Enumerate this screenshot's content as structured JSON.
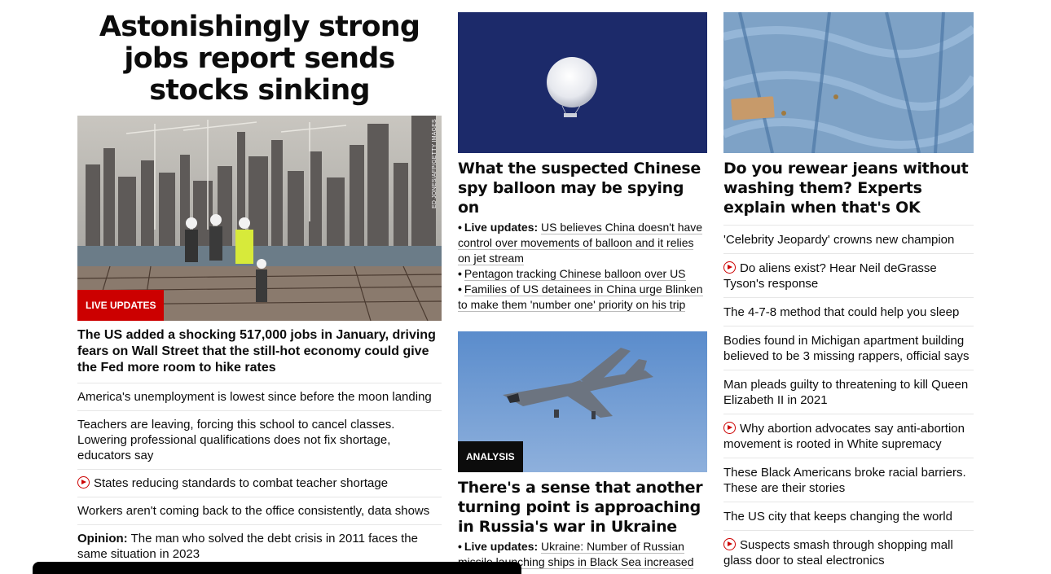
{
  "hero": {
    "title": "Astonishingly strong jobs report sends stocks sinking",
    "photo_credit": "ED JONES/AFP/GETTY IMAGES",
    "badge": "LIVE UPDATES",
    "lead": "The US added a shocking 517,000 jobs in January, driving fears on Wall Street that the still-hot economy could give the Fed more room to hike rates",
    "items": [
      {
        "text": "America's unemployment is lowest since before the moon landing"
      },
      {
        "text": "Teachers are leaving, forcing this school to cancel classes. Lowering professional qualifications does not fix shortage, educators say"
      },
      {
        "text": "States reducing standards to combat teacher shortage",
        "video": true
      },
      {
        "text": "Workers aren't coming back to the office consistently, data shows"
      },
      {
        "prefix": "Opinion:",
        "text": "The man who solved the debt crisis in 2011 faces the same situation in 2023"
      }
    ]
  },
  "balloon": {
    "headline": "What the suspected Chinese spy balloon may be spying on",
    "bullets": [
      {
        "prefix": "Live updates:",
        "text": "US believes China doesn't have control over movements of balloon and it relies on jet stream"
      },
      {
        "text": "Pentagon tracking Chinese balloon over US"
      },
      {
        "text": "Families of US detainees in China urge Blinken to make them 'number one' priority on his trip"
      }
    ]
  },
  "ukraine": {
    "badge": "ANALYSIS",
    "headline": "There's a sense that another turning point is approaching in Russia's war in Ukraine",
    "bullets": [
      {
        "prefix": "Live updates:",
        "text": "Ukraine: Number of Russian missile launching ships in Black Sea increased"
      }
    ]
  },
  "jeans": {
    "headline": "Do you rewear jeans without washing them? Experts explain when that's OK",
    "items": [
      {
        "text": "'Celebrity Jeopardy' crowns new champion"
      },
      {
        "text": "Do aliens exist? Hear Neil deGrasse Tyson's response",
        "video": true
      },
      {
        "text": "The 4-7-8 method that could help you sleep"
      },
      {
        "text": "Bodies found in Michigan apartment building believed to be 3 missing rappers, official says"
      },
      {
        "text": "Man pleads guilty to threatening to kill Queen Elizabeth II in 2021"
      },
      {
        "text": "Why abortion advocates say anti-abortion movement is rooted in White supremacy",
        "video": true
      },
      {
        "text": "These Black Americans broke racial barriers. These are their stories"
      },
      {
        "text": "The US city that keeps changing the world"
      },
      {
        "text": "Suspects smash through shopping mall glass door to steal electronics",
        "video": true
      }
    ]
  },
  "colors": {
    "accent": "#cc0000",
    "text": "#0c0c0c",
    "divider": "#e6e6e6"
  }
}
